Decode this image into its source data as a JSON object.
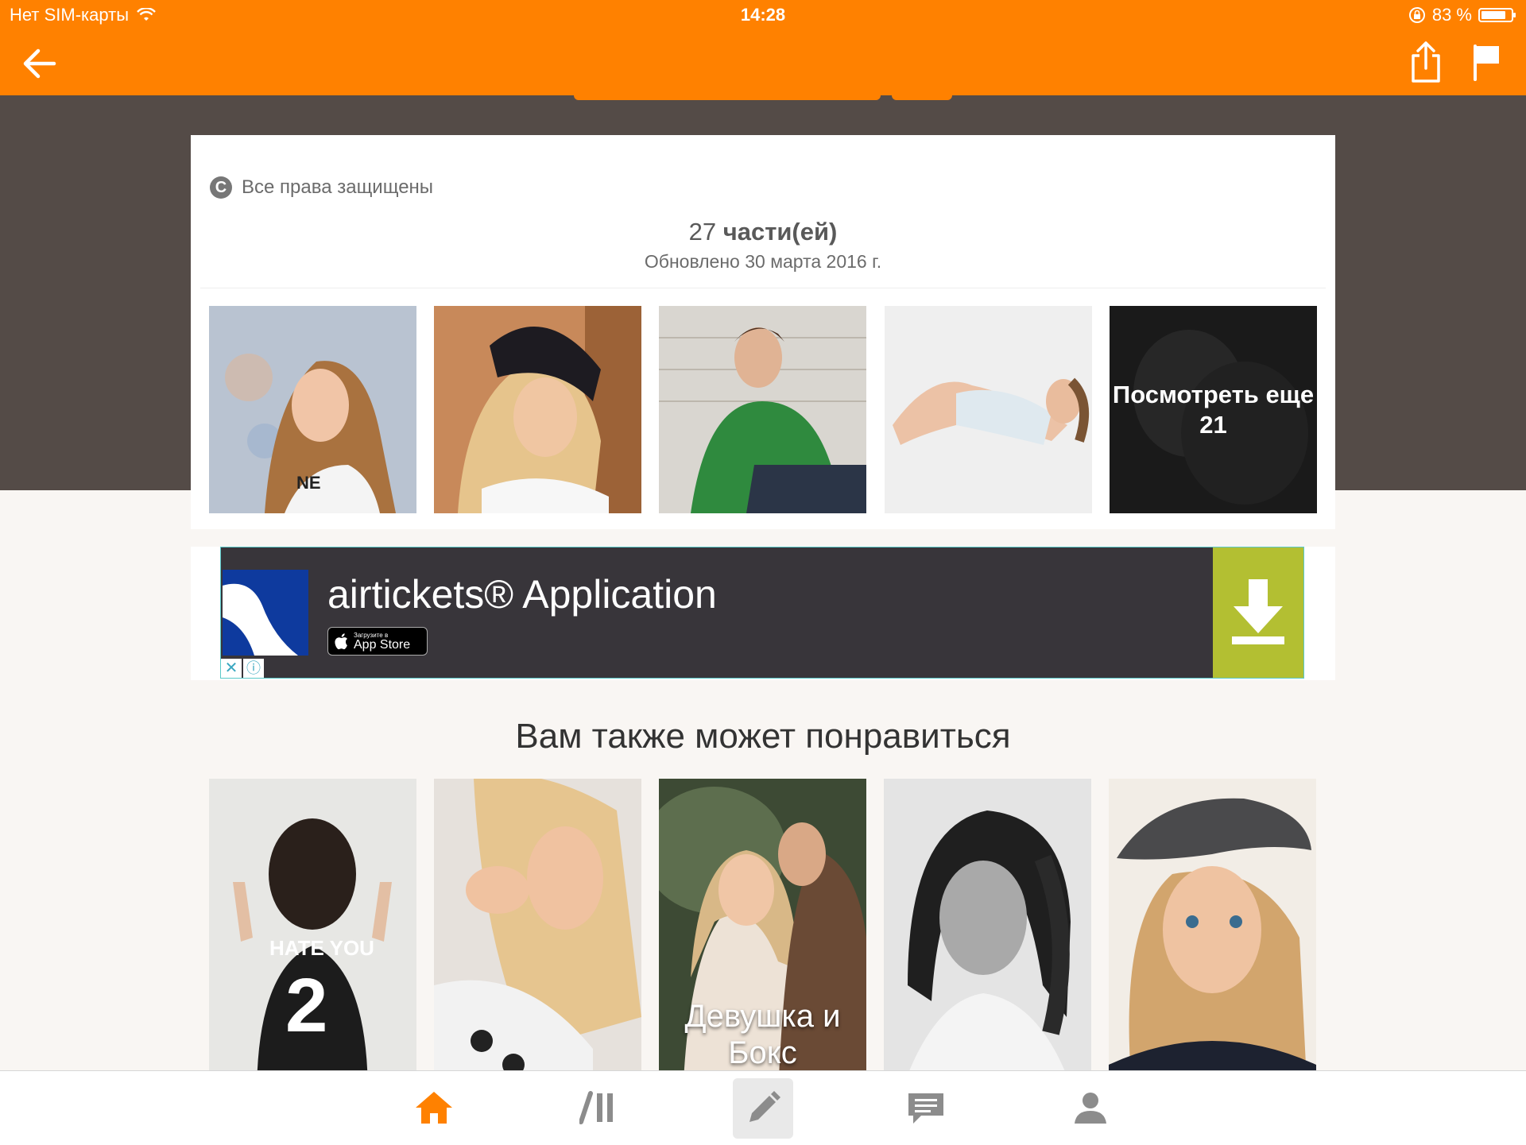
{
  "status_bar": {
    "carrier": "Нет SIM-карты",
    "time": "14:28",
    "battery_text": "83 %",
    "battery_level": 0.83
  },
  "story": {
    "copyright": "Все права защищены",
    "parts_count": "27",
    "parts_label": "части(ей)",
    "updated": "Обновлено 30 марта 2016 г.",
    "more_text": "Посмотреть еще 21"
  },
  "ad": {
    "title": "airtickets® Application",
    "store_small": "Загрузите в",
    "store_big": "App Store"
  },
  "recommendations": {
    "heading": "Вам также может понравиться",
    "items": [
      {
        "caption": ""
      },
      {
        "caption": ""
      },
      {
        "caption": "Девушка и Бокс"
      },
      {
        "caption": ""
      },
      {
        "caption": ""
      }
    ],
    "shirt_text": "HATE YOU 2"
  },
  "colors": {
    "accent": "#ff8100",
    "dark_band": "#544b47",
    "ad_bg": "#38353a",
    "ad_download": "#b3bf32"
  },
  "tabs": [
    {
      "name": "home",
      "icon": "home-icon",
      "active": true
    },
    {
      "name": "library",
      "icon": "library-icon",
      "active": false
    },
    {
      "name": "write",
      "icon": "pencil-icon",
      "active": false
    },
    {
      "name": "messages",
      "icon": "messages-icon",
      "active": false
    },
    {
      "name": "profile",
      "icon": "profile-icon",
      "active": false
    }
  ]
}
